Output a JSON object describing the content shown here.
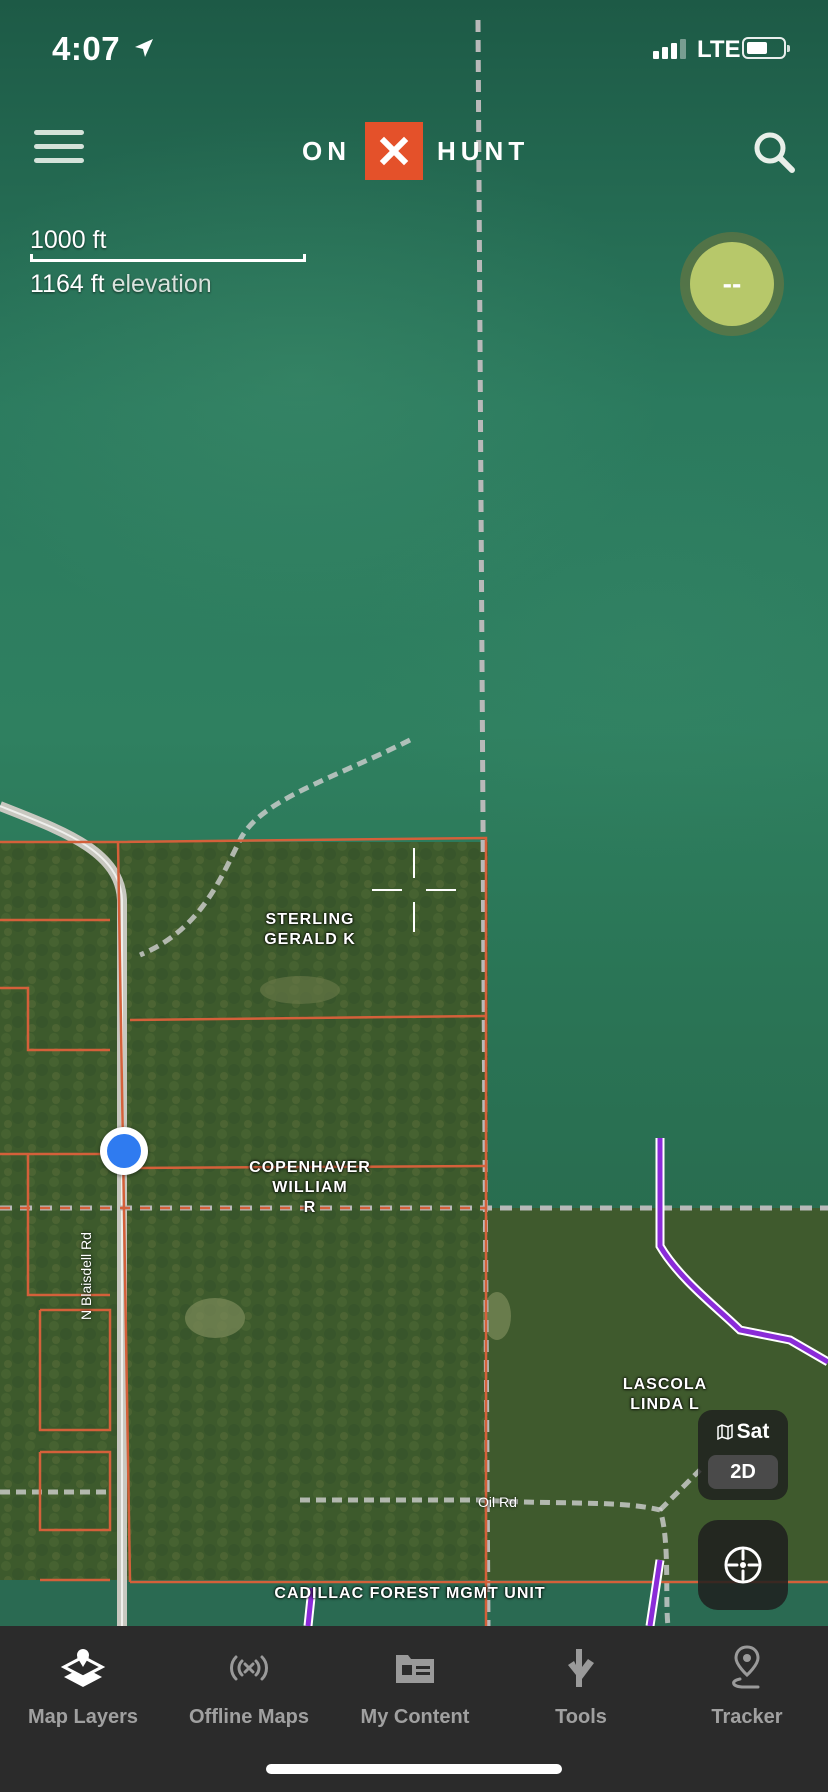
{
  "status_bar": {
    "time": "4:07",
    "carrier": "LTE"
  },
  "header": {
    "logo_left": "ON",
    "logo_right": "HUNT",
    "logo_mark": "✕"
  },
  "map": {
    "scale_label": "1000 ft",
    "elevation_value": "1164 ft",
    "elevation_suffix": "elevation",
    "compass_value": "--",
    "parcels": [
      {
        "owner": "STERLING\nGERALD K"
      },
      {
        "owner": "COPENHAVER\nWILLIAM\nR"
      },
      {
        "owner": "LASCOLA\nLINDA L"
      },
      {
        "owner": "CADILLAC FOREST MGMT UNIT"
      }
    ],
    "roads": [
      {
        "name": "N Blaisdell Rd"
      },
      {
        "name": "Oil Rd"
      }
    ],
    "layer_toggle": {
      "basemap": "Sat",
      "view_mode": "2D"
    }
  },
  "tabs": [
    {
      "label": "Map Layers",
      "icon": "layers-icon"
    },
    {
      "label": "Offline Maps",
      "icon": "offline-signal-icon"
    },
    {
      "label": "My Content",
      "icon": "folder-icon"
    },
    {
      "label": "Tools",
      "icon": "tools-icon"
    },
    {
      "label": "Tracker",
      "icon": "tracker-icon"
    }
  ],
  "colors": {
    "brand_orange": "#e4512a",
    "parcel_line": "#d4603a",
    "boundary_purple": "#8a2bd8",
    "user_location": "#2f7bf0",
    "tab_bar": "#2b2b2b"
  }
}
